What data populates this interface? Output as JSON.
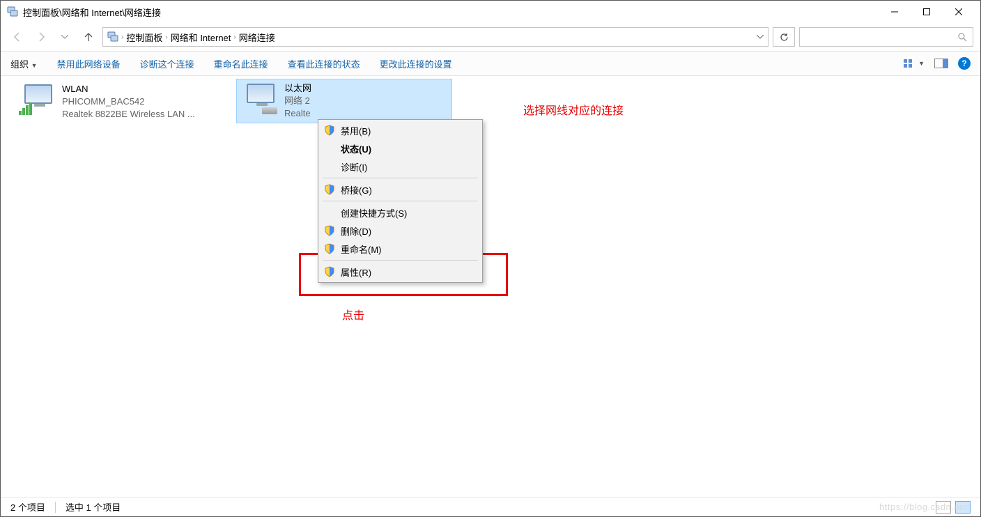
{
  "window": {
    "title": "控制面板\\网络和 Internet\\网络连接"
  },
  "breadcrumb": {
    "items": [
      "控制面板",
      "网络和 Internet",
      "网络连接"
    ]
  },
  "cmdbar": {
    "organize": "组织",
    "items": [
      "禁用此网络设备",
      "诊断这个连接",
      "重命名此连接",
      "查看此连接的状态",
      "更改此连接的设置"
    ]
  },
  "connections": [
    {
      "name": "WLAN",
      "status": "PHICOMM_BAC542",
      "device": "Realtek 8822BE Wireless LAN ...",
      "type": "wifi"
    },
    {
      "name": "以太网",
      "status": "网络 2",
      "device": "Realte",
      "type": "eth",
      "selected": true
    }
  ],
  "context_menu": {
    "disable": "禁用(B)",
    "status": "状态(U)",
    "diagnose": "诊断(I)",
    "bridge": "桥接(G)",
    "shortcut": "创建快捷方式(S)",
    "delete": "删除(D)",
    "rename": "重命名(M)",
    "properties": "属性(R)"
  },
  "annotations": {
    "select_label": "选择网线对应的连接",
    "click_label": "点击"
  },
  "statusbar": {
    "count": "2 个项目",
    "selected": "选中 1 个项目"
  },
  "watermark": "https://blog.csdn.net/"
}
